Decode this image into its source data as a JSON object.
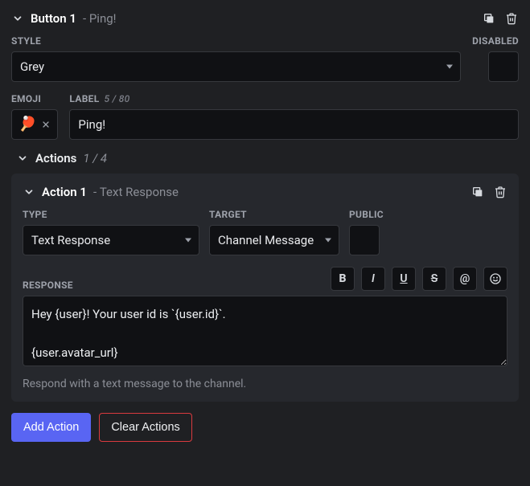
{
  "button": {
    "title": "Button 1",
    "subtitle_prefix": "-",
    "subtitle": "Ping!"
  },
  "style": {
    "label": "STYLE",
    "value": "Grey"
  },
  "disabled": {
    "label": "DISABLED",
    "checked": false
  },
  "emoji": {
    "label": "EMOJI",
    "value": "🏓"
  },
  "labelField": {
    "label": "LABEL",
    "count": "5 / 80",
    "value": "Ping!"
  },
  "actionsSection": {
    "title": "Actions",
    "count": "1 / 4"
  },
  "action": {
    "title": "Action 1",
    "subtitle_prefix": "-",
    "subtitle": "Text Response",
    "type": {
      "label": "TYPE",
      "value": "Text Response"
    },
    "target": {
      "label": "TARGET",
      "value": "Channel Message"
    },
    "public": {
      "label": "PUBLIC",
      "checked": false
    },
    "response": {
      "label": "RESPONSE",
      "value": "Hey {user}! Your user id is `{user.id}`.\n\n{user.avatar_url}",
      "hint": "Respond with a text message to the channel."
    },
    "toolbar": {
      "bold": "B",
      "italic": "I",
      "underline": "U",
      "strike": "S",
      "mention": "@",
      "emoji": "☺"
    }
  },
  "footer": {
    "add": "Add Action",
    "clear": "Clear Actions"
  }
}
